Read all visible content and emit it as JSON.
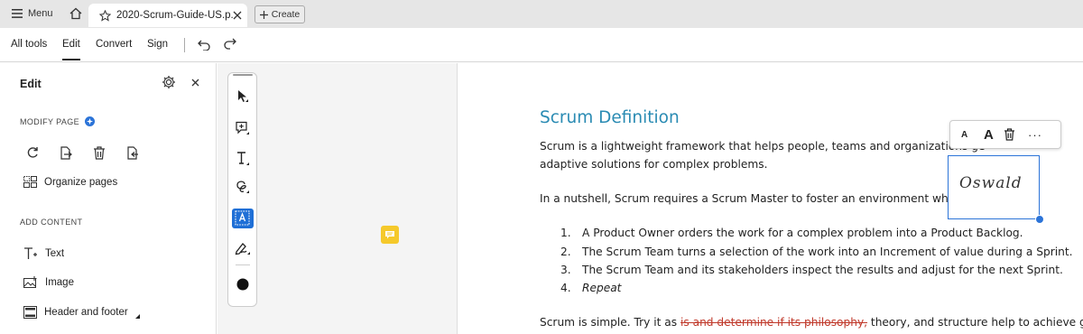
{
  "tabbar": {
    "menu_label": "Menu",
    "doc_tab_title": "2020-Scrum-Guide-US.p...",
    "create_label": "Create"
  },
  "menubar": {
    "items": [
      "All tools",
      "Edit",
      "Convert",
      "Sign"
    ],
    "active": "Edit"
  },
  "panel": {
    "title": "Edit",
    "modify_page_heading": "MODIFY PAGE",
    "organize_pages": "Organize pages",
    "add_content_heading": "ADD CONTENT",
    "items": [
      "Text",
      "Image",
      "Header and footer"
    ]
  },
  "document": {
    "heading": "Scrum Definition",
    "para1_line1": "Scrum is a lightweight framework that helps people, teams and organizations ge",
    "para1_line2": "adaptive solutions for complex problems.",
    "para2": "In a nutshell, Scrum requires a Scrum Master to foster an environment where:",
    "list": [
      {
        "num": "1.",
        "text": "A Product Owner orders the work for a complex problem into a Product Backlog."
      },
      {
        "num": "2.",
        "text": "The Scrum Team turns a selection of the work into an Increment of value during a Sprint."
      },
      {
        "num": "3.",
        "text": "The Scrum Team and its stakeholders inspect the results and adjust for the next Sprint."
      },
      {
        "num": "4.",
        "text": "Repeat"
      }
    ],
    "last_before": "Scrum is simple. Try it as ",
    "last_struck": "is and determine if its philosophy,",
    "last_after": " theory, and structure help to achieve goals"
  },
  "signature": {
    "text": "Oswald",
    "font_small": "A",
    "font_large": "A",
    "more": "···"
  },
  "colors": {
    "heading": "#2a8bb3",
    "accent": "#1f6fd6",
    "note": "#f5c92b",
    "strike": "#c0392b"
  }
}
